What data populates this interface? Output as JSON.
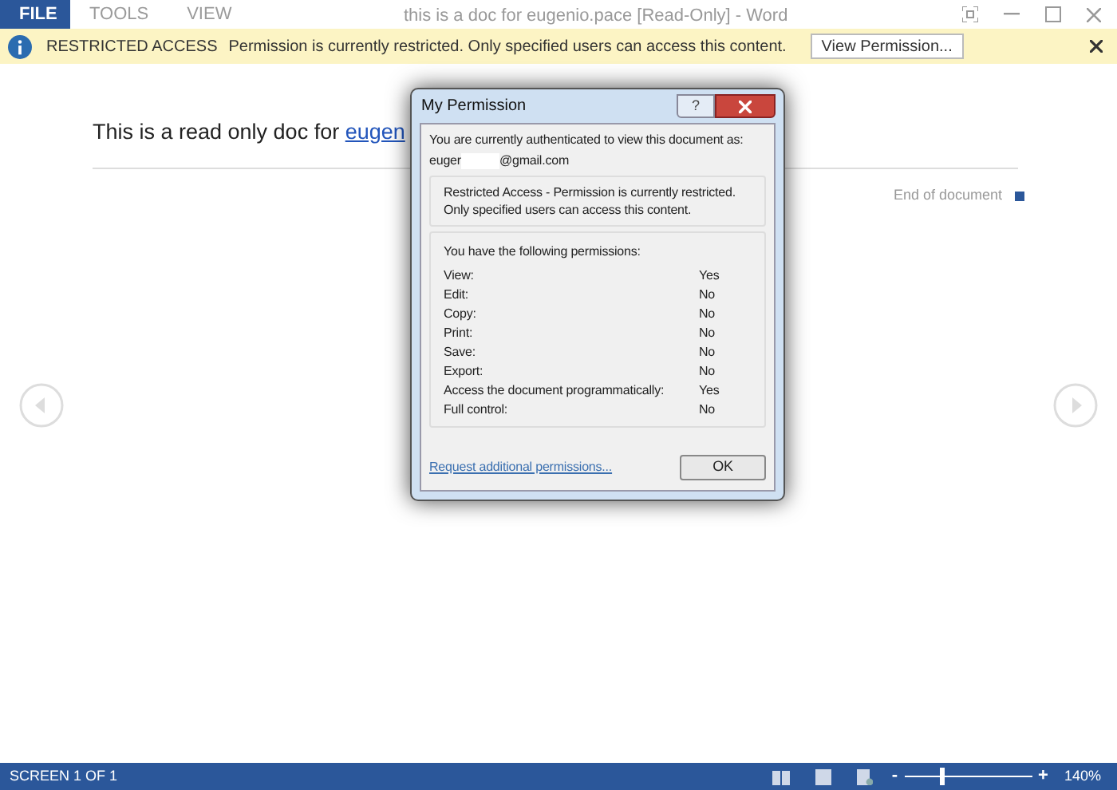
{
  "menu": [
    {
      "label": "FILE",
      "selected": true
    },
    {
      "label": "TOOLS",
      "selected": false
    },
    {
      "label": "VIEW",
      "selected": false
    }
  ],
  "window": {
    "title": "this is a doc for eugenio.pace [Read-Only] - Word"
  },
  "info_bar": {
    "heading": "RESTRICTED ACCESS",
    "message": "Permission is currently restricted. Only specified users can access this content.",
    "button": "View Permission..."
  },
  "document": {
    "text": "This is a read only doc for ",
    "link": "eugen",
    "end_label": "End of document"
  },
  "dialog": {
    "title": "My Permission",
    "help": "?",
    "intro": "You are currently authenticated to view this document as:",
    "email_start": "euger",
    "email_end": "@gmail.com",
    "notice": "Restricted Access - Permission is currently restricted. Only specified users can access this content.",
    "permissions_heading": "You have the following permissions:",
    "permissions": [
      {
        "name": "View:",
        "value": "Yes"
      },
      {
        "name": "Edit:",
        "value": "No"
      },
      {
        "name": "Copy:",
        "value": "No"
      },
      {
        "name": "Print:",
        "value": "No"
      },
      {
        "name": "Save:",
        "value": "No"
      },
      {
        "name": "Export:",
        "value": "No"
      },
      {
        "name": "Access the document programmatically:",
        "value": "Yes"
      },
      {
        "name": "Full control:",
        "value": "No"
      }
    ],
    "link": "Request additional permissions...",
    "ok": "OK"
  },
  "status_bar": {
    "screen": "SCREEN 1 OF 1",
    "zoom": {
      "level": 0.28,
      "minus": "-",
      "plus": "+",
      "reading": "140%"
    }
  }
}
